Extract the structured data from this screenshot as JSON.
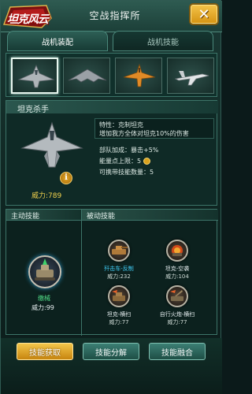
{
  "header": {
    "logo_text": "坦克风云",
    "title": "空战指挥所",
    "close_symbol": "✕"
  },
  "tabs": [
    {
      "label": "战机装配",
      "active": true
    },
    {
      "label": "战机技能",
      "active": false
    }
  ],
  "planes": [
    {
      "icon": "stealth-fighter-icon",
      "selected": true
    },
    {
      "icon": "stealth-bomber-icon",
      "selected": false
    },
    {
      "icon": "orange-fighter-icon",
      "selected": false
    },
    {
      "icon": "white-jet-icon",
      "selected": false
    }
  ],
  "detail": {
    "plane_name": "坦克杀手",
    "power_label": "威力:789",
    "trait_title": "特性：克制坦克",
    "trait_desc": "增加我方全体对坦克10%的伤害",
    "stat_crit": "部队加成：暴击+5%",
    "stat_energy": "能量点上限：5",
    "stat_skills": "可携带技能数量：5",
    "info_symbol": "i"
  },
  "skills": {
    "active_header": "主动技能",
    "passive_header": "被动技能",
    "active": {
      "name": "缴械",
      "power": "威力:99"
    },
    "passive": [
      {
        "name": "歼击车-反制",
        "power": "威力:232",
        "highlight": true
      },
      {
        "name": "坦克-空袭",
        "power": "威力:104",
        "highlight": false
      },
      {
        "name": "坦克-横扫",
        "power": "威力:77",
        "highlight": false
      },
      {
        "name": "自行火炮-横扫",
        "power": "威力:77",
        "highlight": false
      }
    ]
  },
  "buttons": {
    "acquire": "技能获取",
    "decompose": "技能分解",
    "fuse": "技能融合"
  },
  "colors": {
    "gold": "#f2d24d",
    "accent_green": "#52e08a",
    "highlight_blue": "#42d4ff"
  }
}
